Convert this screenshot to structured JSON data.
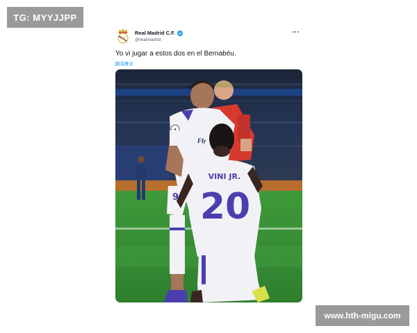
{
  "watermarks": {
    "top_left": "TG: MYYJJPP",
    "bottom_right": "www.hth-migu.com"
  },
  "tweet": {
    "author_name": "Real Madrid C.F.",
    "author_handle": "@realmadrid",
    "text": "Yo vi jugar a estos dos en el Bernabéu.",
    "translate_label": "翻译推文",
    "photo": {
      "player_left_number": "9",
      "player_right_name": "VINI JR.",
      "player_right_number": "20",
      "sponsor": "Emirates"
    },
    "icons": {
      "avatar": "real-madrid-crest-icon",
      "verified": "verified-badge-icon",
      "more": "more-options-icon"
    },
    "colors": {
      "verified": "#1d9bf0",
      "link": "#1d9bf0",
      "pitch": "#3f9a3a",
      "kit_white": "#f2f2f6",
      "kit_purple": "#4b3fb0",
      "referee_red": "#d63a2f"
    }
  }
}
